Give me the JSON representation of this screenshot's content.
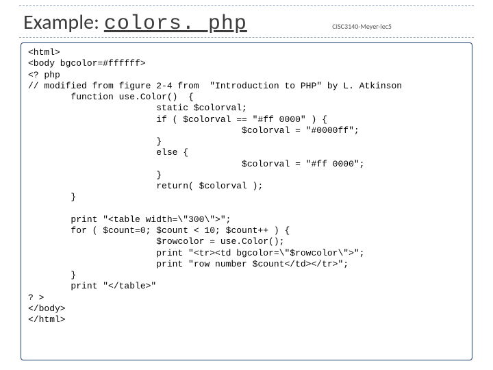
{
  "header": {
    "title_prefix": "Example: ",
    "title_link": "colors. php",
    "course_tag": "CISC3140-Meyer-lec5"
  },
  "code": {
    "lines": [
      "<html>",
      "<body bgcolor=#ffffff>",
      "<? php",
      "// modified from figure 2-4 from  \"Introduction to PHP\" by L. Atkinson",
      "        function use.Color()  {",
      "                        static $colorval;",
      "                        if ( $colorval == \"#ff 0000\" ) {",
      "                                        $colorval = \"#0000ff\";",
      "                        }",
      "                        else {",
      "                                        $colorval = \"#ff 0000\";",
      "                        }",
      "                        return( $colorval );",
      "        }",
      "",
      "        print \"<table width=\\\"300\\\">\";",
      "        for ( $count=0; $count < 10; $count++ ) {",
      "                        $rowcolor = use.Color();",
      "                        print \"<tr><td bgcolor=\\\"$rowcolor\\\">\";",
      "                        print \"row number $count</td></tr>\";",
      "        }",
      "        print \"</table>\"",
      "? >",
      "</body>",
      "</html>"
    ]
  }
}
